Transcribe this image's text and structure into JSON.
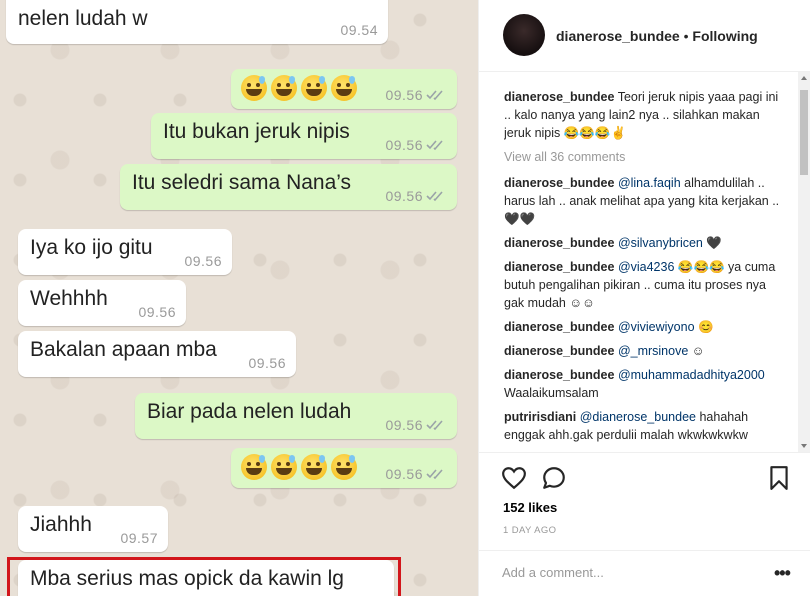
{
  "chat": {
    "messages": [
      {
        "dir": "in",
        "text": "nelen ludah w",
        "time": "09.54"
      },
      {
        "dir": "out",
        "emoji": "😅😅😅😅",
        "time": "09.56"
      },
      {
        "dir": "out",
        "text": "Itu bukan jeruk nipis",
        "time": "09.56"
      },
      {
        "dir": "out",
        "text": "Itu seledri sama Nana’s",
        "time": "09.56"
      },
      {
        "dir": "in",
        "text": "Iya ko ijo gitu",
        "time": "09.56"
      },
      {
        "dir": "in",
        "text": "Wehhhh",
        "time": "09.56"
      },
      {
        "dir": "in",
        "text": "Bakalan apaan mba",
        "time": "09.56"
      },
      {
        "dir": "out",
        "text": "Biar pada nelen ludah",
        "time": "09.56"
      },
      {
        "dir": "out",
        "emoji": "😅😅😅😅",
        "time": "09.56"
      },
      {
        "dir": "in",
        "text": "Jiahhh",
        "time": "09.57"
      },
      {
        "dir": "in",
        "text": "Mba serius mas opick da kawin lg",
        "time": ""
      }
    ]
  },
  "post": {
    "header": {
      "username": "dianerose_bundee",
      "separator": " • ",
      "follow_status": "Following"
    },
    "caption": {
      "username": "dianerose_bundee",
      "text": "Teori jeruk nipis yaaa pagi ini .. kalo nanya yang lain2 nya .. silahkan makan jeruk nipis 😂😂😂✌"
    },
    "view_all": "View all 36 comments",
    "comments": [
      {
        "username": "dianerose_bundee",
        "mention": "@lina.faqih",
        "text": " alhamdulilah .. harus lah .. anak melihat apa yang kita kerjakan .. 🖤🖤"
      },
      {
        "username": "dianerose_bundee",
        "mention": "@silvanybricen",
        "text": " 🖤"
      },
      {
        "username": "dianerose_bundee",
        "mention": "@via4236",
        "text": " 😂😂😂 ya cuma butuh pengalihan pikiran .. cuma itu proses nya gak mudah ☺☺"
      },
      {
        "username": "dianerose_bundee",
        "mention": "@viviewiyono",
        "text": " 😊"
      },
      {
        "username": "dianerose_bundee",
        "mention": "@_mrsinove",
        "text": " ☺"
      },
      {
        "username": "dianerose_bundee",
        "mention": "@muhammadadhitya2000",
        "text": " Waalaikumsalam"
      },
      {
        "username": "putririsdiani",
        "mention": "@dianerose_bundee",
        "text": " hahahah enggak ahh.gak perdulii malah wkwkwkwkw"
      }
    ],
    "likes": "152 likes",
    "time_ago": "1 DAY AGO",
    "add_comment_placeholder": "Add a comment...",
    "more_label": "•••"
  },
  "colors": {
    "highlight": "#d2161b",
    "bubble_out": "#dcf8c6",
    "bubble_in": "#ffffff",
    "mention": "#003569"
  }
}
